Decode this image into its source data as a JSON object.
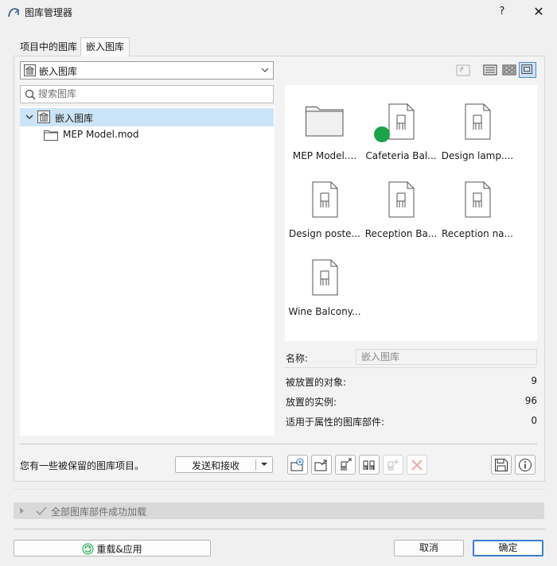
{
  "window": {
    "title": "图库管理器",
    "help_label": "?",
    "close_label": "✕"
  },
  "tabs": [
    {
      "label": "项目中的图库"
    },
    {
      "label": "嵌入图库"
    }
  ],
  "library_select": {
    "value": "嵌入图库"
  },
  "search": {
    "placeholder": "搜索图库"
  },
  "tree": {
    "root_label": "嵌入图库",
    "children": [
      {
        "label": "MEP Model.mod"
      }
    ]
  },
  "gallery": {
    "items": [
      {
        "caption": "MEP Model....",
        "kind": "folder-icon"
      },
      {
        "caption": "Cafeteria Bal...",
        "kind": "chair-doc-icon"
      },
      {
        "caption": "Design lamp....",
        "kind": "chair-doc-icon"
      },
      {
        "caption": "Design poste...",
        "kind": "chair-doc-icon"
      },
      {
        "caption": "Reception Ba...",
        "kind": "chair-doc-icon"
      },
      {
        "caption": "Reception na...",
        "kind": "chair-doc-icon"
      },
      {
        "caption": "Wine Balcony...",
        "kind": "chair-doc-icon"
      }
    ]
  },
  "properties": {
    "name_label": "名称:",
    "name_value": "嵌入图库",
    "placed_objects_label": "被放置的对象:",
    "placed_objects_value": "9",
    "placed_instances_label": "放置的实例:",
    "placed_instances_value": "96",
    "attribute_parts_label": "适用于属性的图库部件:",
    "attribute_parts_value": "0"
  },
  "bottom": {
    "reserved_text": "您有一些被保留的图库项目。",
    "send_receive_label": "发送和接收"
  },
  "status": {
    "text": "全部图库部件成功加载"
  },
  "footer": {
    "reload_label": "重载&应用",
    "cancel_label": "取消",
    "ok_label": "确定"
  },
  "colors": {
    "selection": "#cce4f7",
    "accent": "#3c7fd0",
    "green_dot": "#1ca24a",
    "disabled_red": "#f0a8a8"
  }
}
